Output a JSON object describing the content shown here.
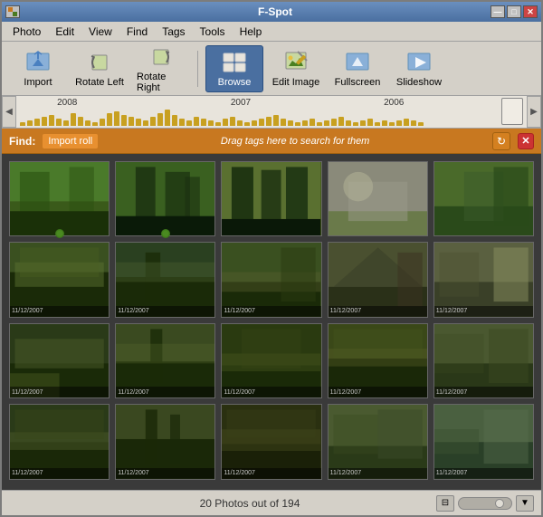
{
  "window": {
    "title": "F-Spot",
    "buttons": {
      "minimize": "—",
      "maximize": "□",
      "close": "✕"
    }
  },
  "menubar": {
    "items": [
      "Photo",
      "Edit",
      "View",
      "Find",
      "Tags",
      "Tools",
      "Help"
    ]
  },
  "toolbar": {
    "buttons": [
      {
        "id": "import",
        "label": "Import",
        "icon": "import-icon"
      },
      {
        "id": "rotate-left",
        "label": "Rotate Left",
        "icon": "rotate-left-icon"
      },
      {
        "id": "rotate-right",
        "label": "Rotate Right",
        "icon": "rotate-right-icon"
      },
      {
        "id": "browse",
        "label": "Browse",
        "icon": "browse-icon",
        "active": true
      },
      {
        "id": "edit-image",
        "label": "Edit Image",
        "icon": "edit-image-icon"
      },
      {
        "id": "fullscreen",
        "label": "Fullscreen",
        "icon": "fullscreen-icon"
      },
      {
        "id": "slideshow",
        "label": "Slideshow",
        "icon": "slideshow-icon"
      }
    ]
  },
  "timeline": {
    "labels": [
      "2008",
      "2007",
      "2006"
    ],
    "label_positions": [
      "8%",
      "43%",
      "72%"
    ]
  },
  "findbar": {
    "label": "Find:",
    "tag": "Import roll",
    "hint": "Drag tags here to search for them"
  },
  "photos": {
    "grid": [
      {
        "id": 1,
        "class": "p1",
        "date": "",
        "has_geo": true
      },
      {
        "id": 2,
        "class": "p2",
        "date": "",
        "has_geo": true
      },
      {
        "id": 3,
        "class": "p3",
        "date": "",
        "has_geo": false
      },
      {
        "id": 4,
        "class": "p4",
        "date": "",
        "has_geo": false
      },
      {
        "id": 5,
        "class": "p5",
        "date": "",
        "has_geo": false
      },
      {
        "id": 6,
        "class": "p6",
        "date": "11/12/2007",
        "has_geo": false
      },
      {
        "id": 7,
        "class": "p7",
        "date": "11/12/2007",
        "has_geo": false
      },
      {
        "id": 8,
        "class": "p8",
        "date": "11/12/2007",
        "has_geo": false
      },
      {
        "id": 9,
        "class": "p9",
        "date": "11/12/2007",
        "has_geo": false
      },
      {
        "id": 10,
        "class": "p10",
        "date": "11/12/2007",
        "has_geo": false
      },
      {
        "id": 11,
        "class": "p11",
        "date": "11/12/2007",
        "has_geo": false
      },
      {
        "id": 12,
        "class": "p12",
        "date": "11/12/2007",
        "has_geo": false
      },
      {
        "id": 13,
        "class": "p13",
        "date": "11/12/2007",
        "has_geo": false
      },
      {
        "id": 14,
        "class": "p14",
        "date": "11/12/2007",
        "has_geo": false
      },
      {
        "id": 15,
        "class": "p15",
        "date": "11/12/2007",
        "has_geo": false
      },
      {
        "id": 16,
        "class": "p16",
        "date": "11/12/2007",
        "has_geo": false
      },
      {
        "id": 17,
        "class": "p17",
        "date": "11/12/2007",
        "has_geo": false
      },
      {
        "id": 18,
        "class": "p18",
        "date": "11/12/2007",
        "has_geo": false
      },
      {
        "id": 19,
        "class": "p19",
        "date": "11/12/2007",
        "has_geo": false
      },
      {
        "id": 20,
        "class": "p20",
        "date": "11/12/2007",
        "has_geo": false
      }
    ]
  },
  "statusbar": {
    "text": "20 Photos out of 194"
  }
}
